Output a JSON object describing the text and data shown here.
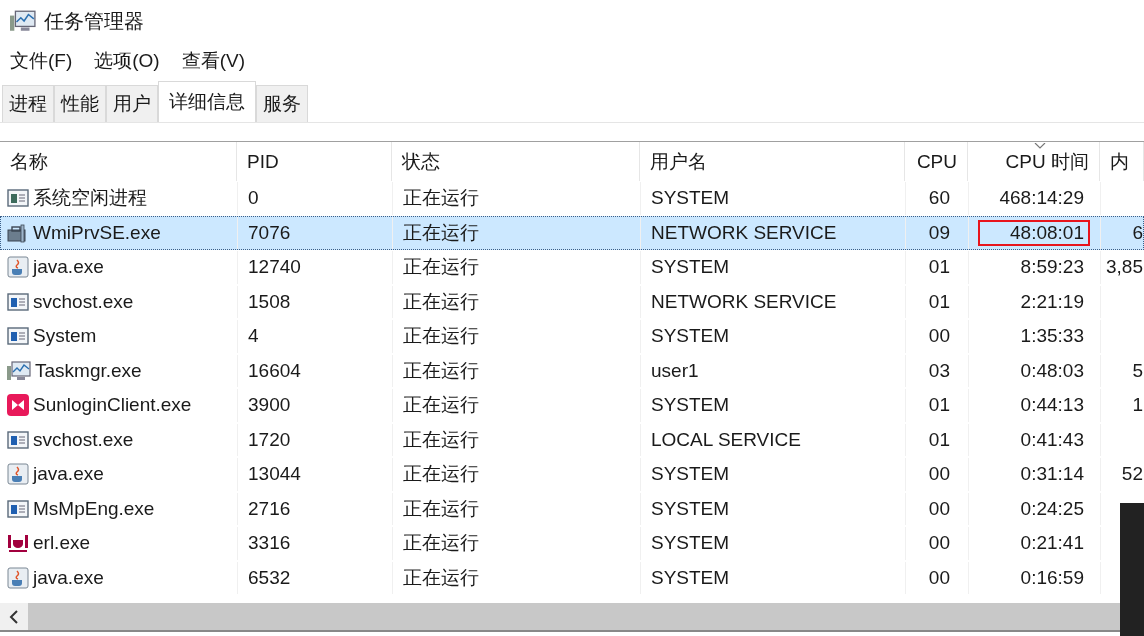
{
  "window": {
    "title": "任务管理器"
  },
  "menu": [
    "文件(F)",
    "选项(O)",
    "查看(V)"
  ],
  "tabs": [
    {
      "label": "进程",
      "selected": false
    },
    {
      "label": "性能",
      "selected": false
    },
    {
      "label": "用户",
      "selected": false
    },
    {
      "label": "详细信息",
      "selected": true
    },
    {
      "label": "服务",
      "selected": false
    }
  ],
  "table": {
    "columns": [
      {
        "label": "名称",
        "sorted": false
      },
      {
        "label": "PID",
        "sorted": false
      },
      {
        "label": "状态",
        "sorted": false
      },
      {
        "label": "用户名",
        "sorted": false
      },
      {
        "label": "CPU",
        "sorted": false
      },
      {
        "label": "CPU 时间",
        "sorted": true
      },
      {
        "label": "内",
        "sorted": false
      }
    ],
    "rows": [
      {
        "kind": "window",
        "name": "系统空闲进程",
        "pid": "0",
        "status": "正在运行",
        "user": "SYSTEM",
        "cpu": "60",
        "cpu_time": "468:14:29",
        "selected": false,
        "marked": false
      },
      {
        "kind": "wmi",
        "name": "WmiPrvSE.exe",
        "pid": "7076",
        "status": "正在运行",
        "user": "NETWORK SERVICE",
        "cpu": "09",
        "cpu_time": "48:08:01",
        "column_7": "6",
        "selected": true,
        "marked": true
      },
      {
        "kind": "java",
        "name": "java.exe",
        "pid": "12740",
        "status": "正在运行",
        "user": "SYSTEM",
        "cpu": "01",
        "cpu_time": "8:59:23",
        "column_7": "3,85",
        "selected": false,
        "marked": false
      },
      {
        "kind": "service",
        "name": "svchost.exe",
        "pid": "1508",
        "status": "正在运行",
        "user": "NETWORK SERVICE",
        "cpu": "01",
        "cpu_time": "2:21:19",
        "selected": false,
        "marked": false
      },
      {
        "kind": "service",
        "name": "System",
        "pid": "4",
        "status": "正在运行",
        "user": "SYSTEM",
        "cpu": "00",
        "cpu_time": "1:35:33",
        "selected": false,
        "marked": false
      },
      {
        "kind": "taskmgr",
        "name": "Taskmgr.exe",
        "pid": "16604",
        "status": "正在运行",
        "user": "user1",
        "cpu": "03",
        "cpu_time": "0:48:03",
        "column_7": "5",
        "selected": false,
        "marked": false
      },
      {
        "kind": "sunlogin",
        "name": "SunloginClient.exe",
        "pid": "3900",
        "status": "正在运行",
        "user": "SYSTEM",
        "cpu": "01",
        "cpu_time": "0:44:13",
        "column_7": "1",
        "selected": false,
        "marked": false
      },
      {
        "kind": "service",
        "name": "svchost.exe",
        "pid": "1720",
        "status": "正在运行",
        "user": "LOCAL SERVICE",
        "cpu": "01",
        "cpu_time": "0:41:43",
        "selected": false,
        "marked": false
      },
      {
        "kind": "java",
        "name": "java.exe",
        "pid": "13044",
        "status": "正在运行",
        "user": "SYSTEM",
        "cpu": "00",
        "cpu_time": "0:31:14",
        "column_7": "52",
        "selected": false,
        "marked": false
      },
      {
        "kind": "service",
        "name": "MsMpEng.exe",
        "pid": "2716",
        "status": "正在运行",
        "user": "SYSTEM",
        "cpu": "00",
        "cpu_time": "0:24:25",
        "selected": false,
        "marked": false
      },
      {
        "kind": "erlang",
        "name": "erl.exe",
        "pid": "3316",
        "status": "正在运行",
        "user": "SYSTEM",
        "cpu": "00",
        "cpu_time": "0:21:41",
        "selected": false,
        "marked": false
      },
      {
        "kind": "java",
        "name": "java.exe",
        "pid": "6532",
        "status": "正在运行",
        "user": "SYSTEM",
        "cpu": "00",
        "cpu_time": "0:16:59",
        "selected": false,
        "marked": false
      }
    ]
  }
}
